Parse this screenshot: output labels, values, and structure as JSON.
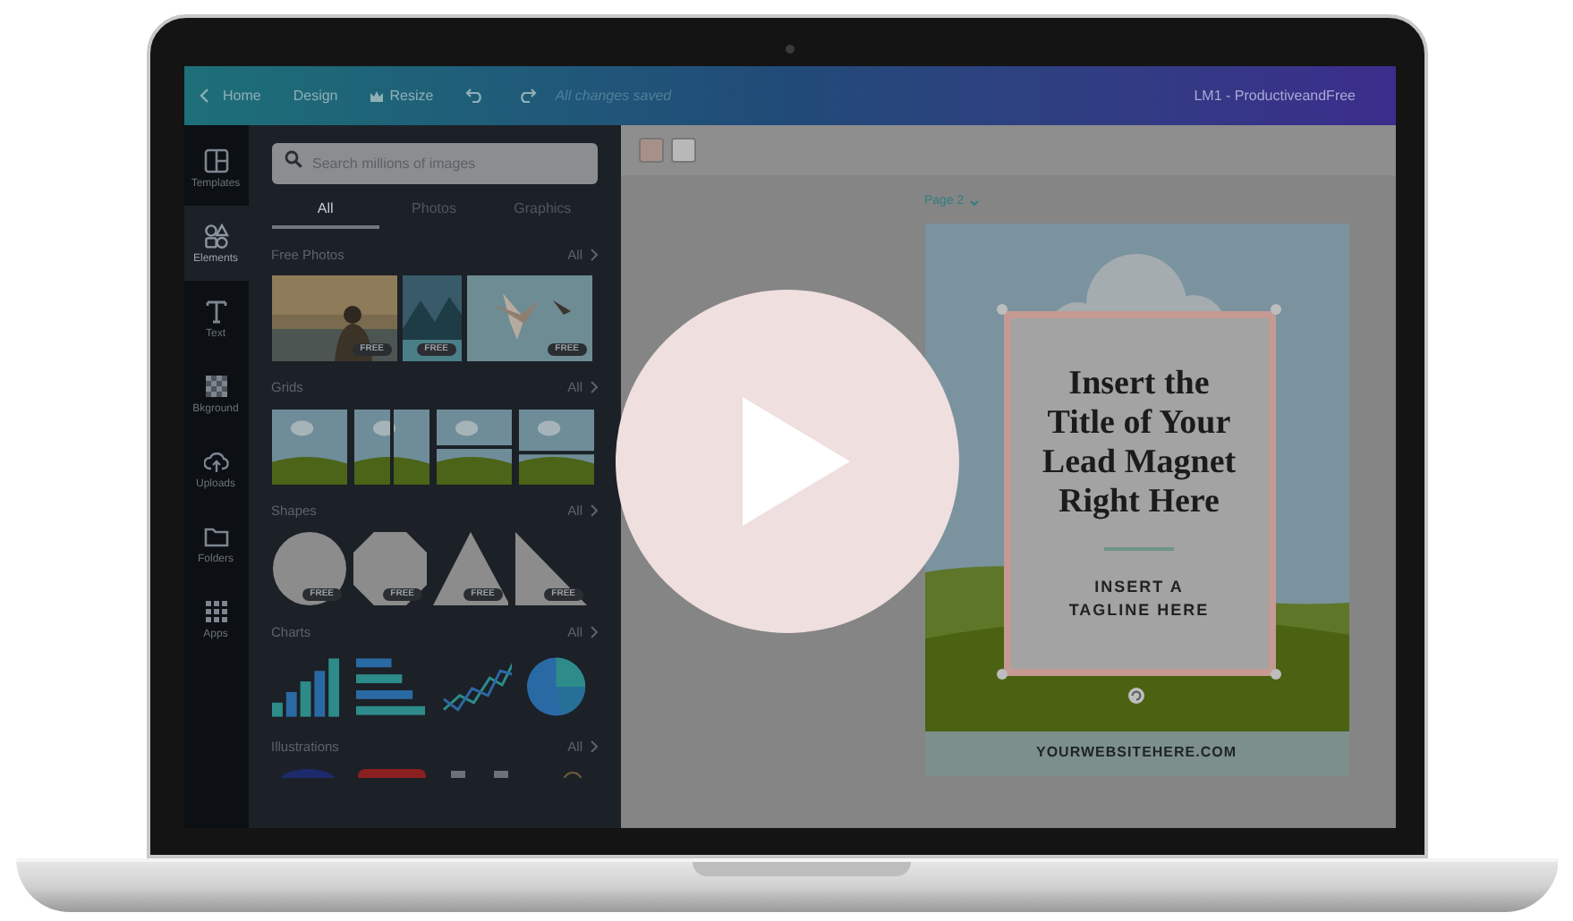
{
  "topbar": {
    "back": "Home",
    "menu": [
      "Design",
      "Resize"
    ],
    "status": "All changes saved",
    "title": "LM1 - ProductiveandFree"
  },
  "rail": [
    {
      "label": "Templates",
      "selected": false
    },
    {
      "label": "Elements",
      "selected": true
    },
    {
      "label": "Text",
      "selected": false
    },
    {
      "label": "Bkground",
      "selected": false
    },
    {
      "label": "Uploads",
      "selected": false
    },
    {
      "label": "Folders",
      "selected": false
    },
    {
      "label": "Apps",
      "selected": false
    }
  ],
  "panel": {
    "search": {
      "placeholder": "Search millions of images"
    },
    "tabs": [
      {
        "label": "All",
        "selected": true
      },
      {
        "label": "Photos",
        "selected": false
      },
      {
        "label": "Graphics",
        "selected": false
      }
    ],
    "sections": [
      {
        "kind": "photos",
        "title": "Free Photos",
        "more": "All",
        "items": [
          {
            "badge": "FREE"
          },
          {
            "badge": "FREE"
          },
          {
            "badge": "FREE"
          }
        ]
      },
      {
        "kind": "grids",
        "title": "Grids",
        "more": "All"
      },
      {
        "kind": "shapes",
        "title": "Shapes",
        "more": "All",
        "items": [
          {
            "kind": "circle",
            "badge": "FREE"
          },
          {
            "kind": "octagon",
            "badge": "FREE"
          },
          {
            "kind": "triangle",
            "badge": "FREE"
          },
          {
            "kind": "right-triangle",
            "badge": "FREE"
          }
        ]
      },
      {
        "kind": "charts",
        "title": "Charts",
        "more": "All",
        "items": [
          {
            "kind": "bar"
          },
          {
            "kind": "hbar"
          },
          {
            "kind": "line"
          },
          {
            "kind": "pie"
          }
        ]
      },
      {
        "kind": "illustrations",
        "title": "Illustrations",
        "more": "All"
      }
    ]
  },
  "canvas": {
    "swatches": [
      {
        "color": "#a8908a"
      },
      {
        "color": "#b8b8b8"
      }
    ],
    "page_label": "Page 2",
    "design": {
      "title": "Insert the Title of Your Lead Magnet Right Here",
      "tagline": "INSERT A TAGLINE HERE",
      "footer": "YOURWEBSITEHERE.COM"
    }
  }
}
